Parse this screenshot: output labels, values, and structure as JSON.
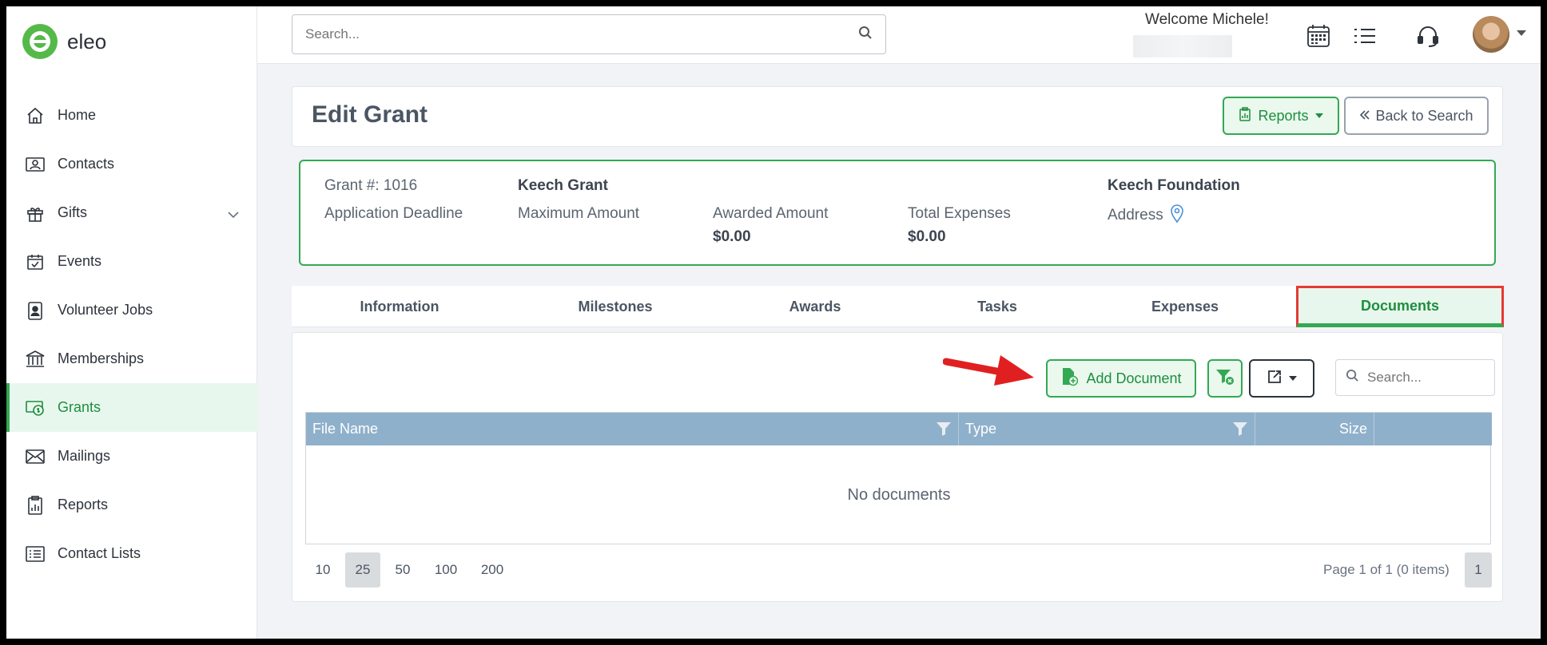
{
  "app": {
    "logo_text": "eleo"
  },
  "sidebar": {
    "items": [
      {
        "label": "Home",
        "icon": "home-icon"
      },
      {
        "label": "Contacts",
        "icon": "contact-card-icon"
      },
      {
        "label": "Gifts",
        "icon": "gift-icon"
      },
      {
        "label": "Events",
        "icon": "calendar-check-icon"
      },
      {
        "label": "Volunteer Jobs",
        "icon": "badge-icon"
      },
      {
        "label": "Memberships",
        "icon": "bank-icon"
      },
      {
        "label": "Grants",
        "icon": "grant-money-icon",
        "active": true
      },
      {
        "label": "Mailings",
        "icon": "envelope-icon"
      },
      {
        "label": "Reports",
        "icon": "clipboard-chart-icon"
      },
      {
        "label": "Contact Lists",
        "icon": "list-icon"
      }
    ]
  },
  "topbar": {
    "search_placeholder": "Search...",
    "welcome": "Welcome Michele!"
  },
  "header": {
    "title": "Edit Grant",
    "reports_label": "Reports",
    "back_label": "Back to Search"
  },
  "summary": {
    "grant_number": "Grant #: 1016",
    "grant_name": "Keech Grant",
    "foundation": "Keech Foundation",
    "application_deadline_label": "Application Deadline",
    "maximum_amount_label": "Maximum Amount",
    "awarded_amount_label": "Awarded Amount",
    "awarded_amount_value": "$0.00",
    "total_expenses_label": "Total Expenses",
    "total_expenses_value": "$0.00",
    "address_label": "Address"
  },
  "tabs": [
    {
      "label": "Information"
    },
    {
      "label": "Milestones"
    },
    {
      "label": "Awards"
    },
    {
      "label": "Tasks"
    },
    {
      "label": "Expenses"
    },
    {
      "label": "Documents",
      "active": true
    }
  ],
  "documents": {
    "add_label": "Add Document",
    "search_placeholder": "Search...",
    "columns": [
      "File Name",
      "Type",
      "Size"
    ],
    "empty_text": "No documents",
    "page_sizes": [
      "10",
      "25",
      "50",
      "100",
      "200"
    ],
    "selected_page_size": "25",
    "page_info": "Page 1 of 1 (0 items)",
    "current_page": "1"
  },
  "colors": {
    "accent_green": "#34a853",
    "highlight_red": "#e53935",
    "grid_header": "#8fb0cb"
  }
}
